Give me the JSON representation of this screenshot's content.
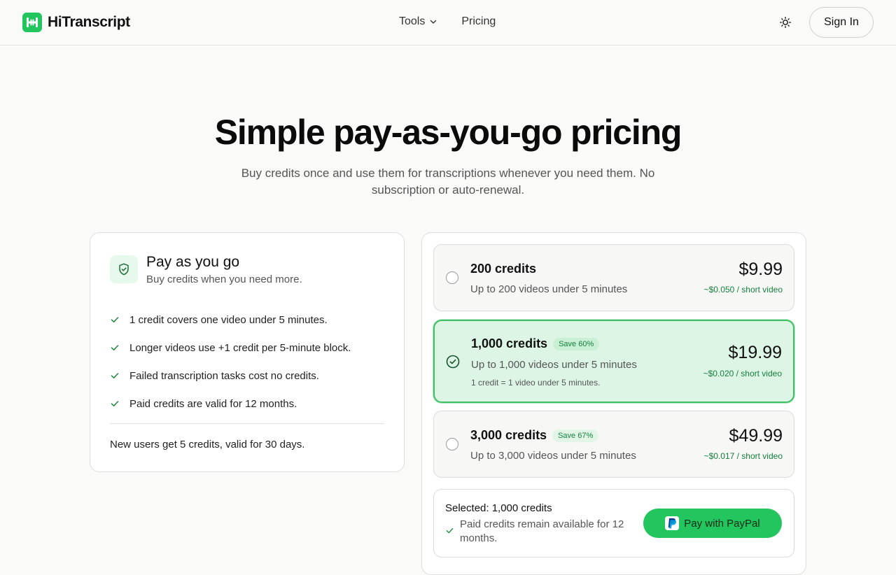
{
  "header": {
    "brand": "HiTranscript",
    "nav": [
      {
        "label": "Tools",
        "has_dropdown": true
      },
      {
        "label": "Pricing",
        "has_dropdown": false
      }
    ],
    "theme_icon": "sun-icon",
    "sign_in_label": "Sign In"
  },
  "hero": {
    "title": "Simple pay-as-you-go pricing",
    "subtitle": "Buy credits once and use them for transcriptions whenever you need them. No subscription or auto-renewal."
  },
  "payg_card": {
    "icon": "shield-check-icon",
    "title": "Pay as you go",
    "subtitle": "Buy credits when you need more.",
    "features": [
      "1 credit covers one video under 5 minutes.",
      "Longer videos use +1 credit per 5-minute block.",
      "Failed transcription tasks cost no credits.",
      "Paid credits are valid for 12 months."
    ],
    "footer": "New users get 5 credits, valid for 30 days."
  },
  "plans": [
    {
      "name": "200 credits",
      "badge": "",
      "description": "Up to 200 videos under 5 minutes",
      "note": "",
      "price": "$9.99",
      "unit_price": "~$0.050 / short video",
      "selected": false
    },
    {
      "name": "1,000 credits",
      "badge": "Save 60%",
      "description": "Up to 1,000 videos under 5 minutes",
      "note": "1 credit = 1 video under 5 minutes.",
      "price": "$19.99",
      "unit_price": "~$0.020 / short video",
      "selected": true
    },
    {
      "name": "3,000 credits",
      "badge": "Save 67%",
      "description": "Up to 3,000 videos under 5 minutes",
      "note": "",
      "price": "$49.99",
      "unit_price": "~$0.017 / short video",
      "selected": false
    }
  ],
  "checkout": {
    "selected_label": "Selected: 1,000 credits",
    "note": "Paid credits remain available for 12 months.",
    "pay_button_label": "Pay with PayPal"
  },
  "colors": {
    "accent": "#22c55e",
    "accent_dark": "#15803d",
    "selected_bg": "#ddf5e4"
  }
}
